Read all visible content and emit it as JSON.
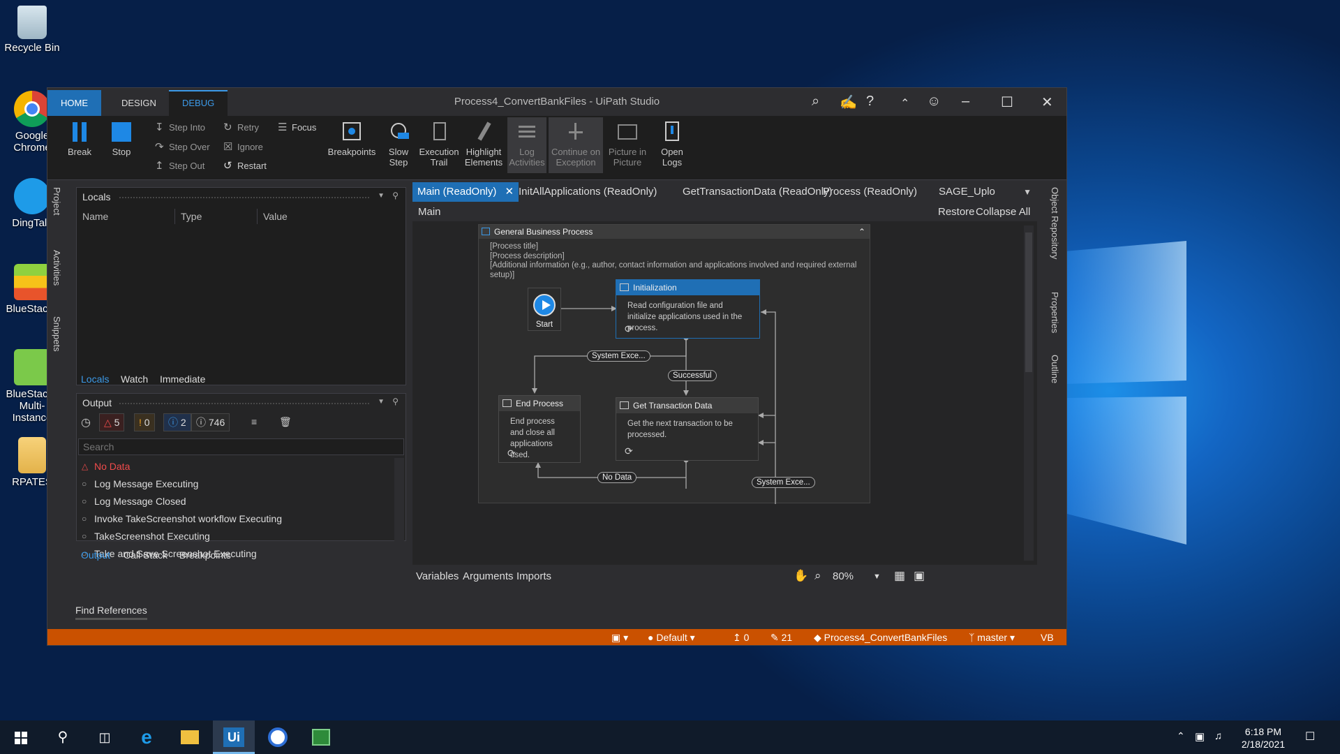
{
  "desktop": {
    "icons": [
      {
        "label": "Recycle Bin"
      },
      {
        "label": "Google Chrome"
      },
      {
        "label": "DingTalk"
      },
      {
        "label": "BlueStacks"
      },
      {
        "label": "BlueStacks Multi-Instance"
      },
      {
        "label": "RPATES"
      }
    ]
  },
  "window": {
    "title": "Process4_ConvertBankFiles - UiPath Studio",
    "tabs": [
      "HOME",
      "DESIGN",
      "DEBUG"
    ]
  },
  "ribbon": {
    "break": "Break",
    "stop": "Stop",
    "step_into": "Step Into",
    "step_over": "Step Over",
    "step_out": "Step Out",
    "retry": "Retry",
    "ignore": "Ignore",
    "restart": "Restart",
    "focus": "Focus",
    "breakpoints": "Breakpoints",
    "slow_step": [
      "Slow",
      "Step"
    ],
    "execution_trail": [
      "Execution",
      "Trail"
    ],
    "highlight_elements": [
      "Highlight",
      "Elements"
    ],
    "log_activities": [
      "Log",
      "Activities"
    ],
    "continue_on_exception": [
      "Continue on",
      "Exception"
    ],
    "picture_in_picture": [
      "Picture in",
      "Picture"
    ],
    "open_logs": [
      "Open",
      "Logs"
    ]
  },
  "left_sidebar": [
    "Project",
    "Activities",
    "Snippets"
  ],
  "right_sidebar": [
    "Object Repository",
    "Properties",
    "Outline"
  ],
  "locals": {
    "title": "Locals",
    "columns": [
      "Name",
      "Type",
      "Value"
    ],
    "tabs": [
      "Locals",
      "Watch",
      "Immediate"
    ]
  },
  "output": {
    "title": "Output",
    "counts": {
      "warnings": "5",
      "errors": "0",
      "info": "2",
      "trace": "746"
    },
    "search_placeholder": "Search",
    "items": [
      {
        "text": "No Data",
        "level": "error"
      },
      {
        "text": "Log Message Executing",
        "level": "trace"
      },
      {
        "text": "Log Message Closed",
        "level": "trace"
      },
      {
        "text": "Invoke TakeScreenshot workflow Executing",
        "level": "trace"
      },
      {
        "text": "TakeScreenshot Executing",
        "level": "trace"
      },
      {
        "text": "Take and Save Screenshot Executing",
        "level": "trace"
      }
    ],
    "tabs": [
      "Output",
      "Call Stack",
      "Breakpoints"
    ]
  },
  "find_references": "Find References",
  "designer": {
    "tabs": [
      "Main (ReadOnly)",
      "InitAllApplications (ReadOnly)",
      "GetTransactionData (ReadOnly)",
      "Process (ReadOnly)",
      "SAGE_Uplo"
    ],
    "breadcrumb": "Main",
    "restore": "Restore",
    "collapse_all": "Collapse All",
    "flowchart": {
      "title": "General Business Process",
      "annotations": [
        "[Process title]",
        "[Process description]",
        "[Additional information (e.g., author, contact information and applications involved and required external setup)]"
      ],
      "start": "Start",
      "initialization": {
        "title": "Initialization",
        "body": "Read configuration file and initialize applications used in the process."
      },
      "end_process": {
        "title": "End Process",
        "body": "End process and close all applications used."
      },
      "get_transaction": {
        "title": "Get Transaction Data",
        "body": "Get the next transaction to be processed."
      },
      "labels": {
        "system_exc_1": "System Exce...",
        "successful": "Successful",
        "no_data": "No Data",
        "system_exc_2": "System Exce..."
      }
    },
    "bottom": {
      "variables": "Variables",
      "arguments": "Arguments",
      "imports": "Imports",
      "zoom": "80%"
    }
  },
  "status_bar": {
    "profile": "Default",
    "publish_count": "0",
    "changes": "21",
    "project": "Process4_ConvertBankFiles",
    "branch": "master",
    "language": "VB"
  },
  "taskbar": {
    "time": "6:18 PM",
    "date": "2/18/2021"
  },
  "colors": {
    "accent": "#1f6fb5",
    "status": "#ca5100",
    "error": "#f04b4b"
  }
}
